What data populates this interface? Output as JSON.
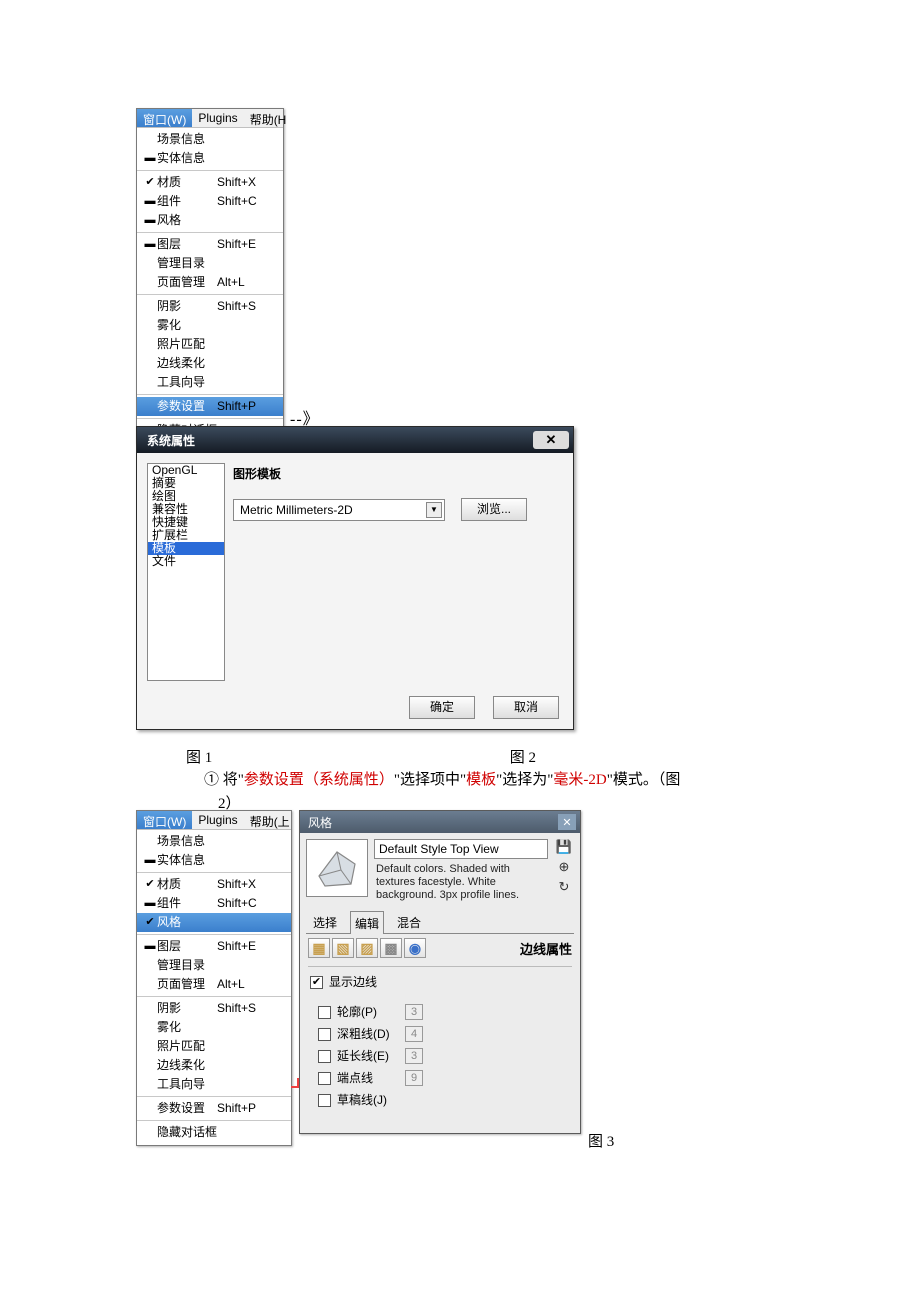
{
  "menu_header": {
    "window": "窗口(W)",
    "plugins": "Plugins",
    "help": "帮助(H"
  },
  "menu1": {
    "scene_info": "场景信息",
    "entity_info": "实体信息",
    "material": "材质",
    "material_sc": "Shift+X",
    "component": "组件",
    "component_sc": "Shift+C",
    "style": "风格",
    "layer": "图层",
    "layer_sc": "Shift+E",
    "outline": "管理目录",
    "pages": "页面管理",
    "pages_sc": "Alt+L",
    "shadow": "阴影",
    "shadow_sc": "Shift+S",
    "fog": "雾化",
    "photomatch": "照片匹配",
    "soften": "边线柔化",
    "instructor": "工具向导",
    "prefs": "参数设置",
    "prefs_sc": "Shift+P",
    "hide": "隐藏对话框"
  },
  "arrow": "--》",
  "dialog": {
    "title": "系统属性",
    "list": {
      "opengl": "OpenGL",
      "summary": "摘要",
      "draw": "绘图",
      "compat": "兼容性",
      "shortcut": "快捷键",
      "extbar": "扩展栏",
      "template": "模板",
      "file": "文件"
    },
    "pane_title": "图形模板",
    "combo_value": "Metric Millimeters-2D",
    "browse": "浏览...",
    "ok": "确定",
    "cancel": "取消"
  },
  "captions": {
    "fig1": "图 1",
    "fig2": "图 2",
    "fig3": "图 3"
  },
  "instruction": {
    "circled1": "①",
    "t1": " 将\"",
    "red1": "参数设置（系统属性）",
    "t2": "\"选择项中\"",
    "red2": "模板",
    "t3": "\"选择为\"",
    "red3": "毫米-2D",
    "t4": "\"模式。（图",
    "line2": "2）"
  },
  "menu2_header_help": "帮助(上",
  "styles": {
    "title": "风格",
    "name": "Default Style Top View",
    "desc": "Default colors.  Shaded with textures facestyle.  White background.  3px profile lines.",
    "tab_select": "选择",
    "tab_edit": "编辑",
    "tab_mix": "混合",
    "edge_props": "边线属性",
    "show_edges": "显示边线",
    "profile": "轮廓(P)",
    "profile_v": "3",
    "depth": "深粗线(D)",
    "depth_v": "4",
    "ext": "延长线(E)",
    "ext_v": "3",
    "endpt": "端点线",
    "endpt_v": "9",
    "sketchy": "草稿线(J)"
  }
}
